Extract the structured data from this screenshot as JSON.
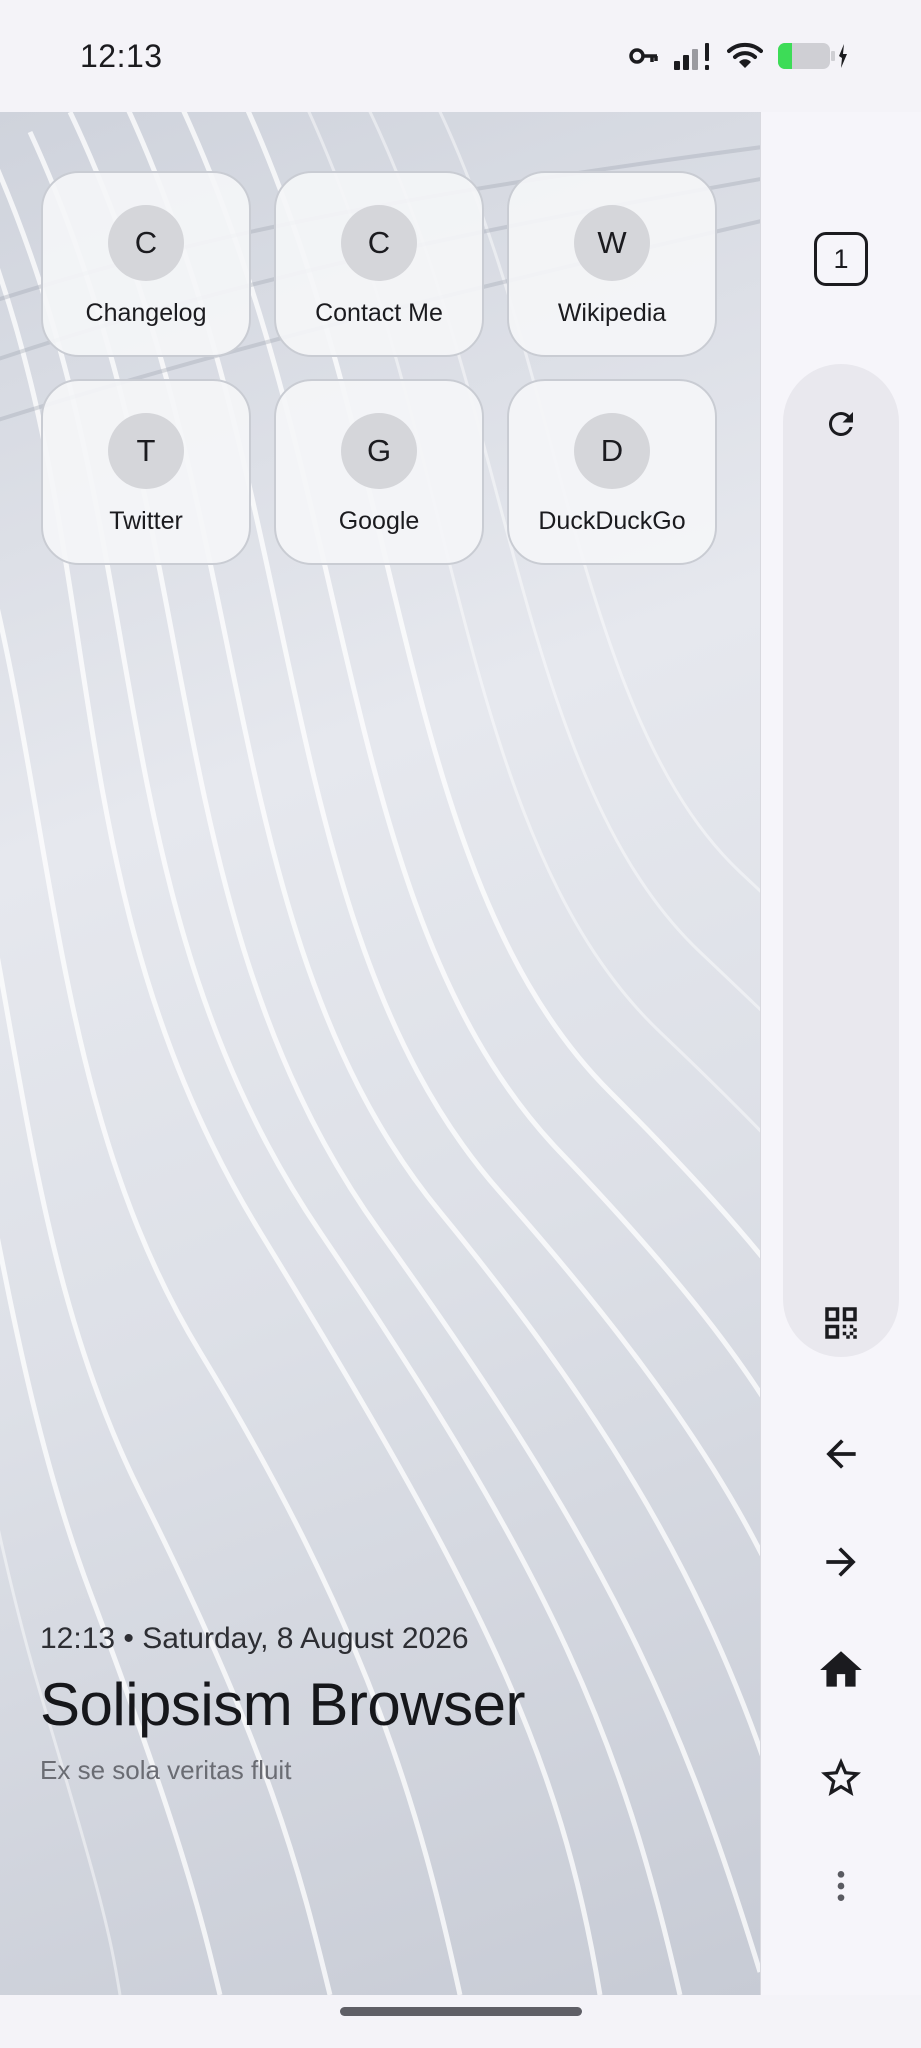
{
  "status_bar": {
    "time": "12:13",
    "icons": [
      "vpn-key-icon",
      "cellular-signal-icon",
      "wifi-icon",
      "battery-charging-icon"
    ],
    "battery_color": "#3ddc57"
  },
  "speed_dial": [
    {
      "initial": "C",
      "label": "Changelog"
    },
    {
      "initial": "C",
      "label": "Contact Me"
    },
    {
      "initial": "W",
      "label": "Wikipedia"
    },
    {
      "initial": "T",
      "label": "Twitter"
    },
    {
      "initial": "G",
      "label": "Google"
    },
    {
      "initial": "D",
      "label": "DuckDuckGo"
    }
  ],
  "info": {
    "datetime": "12:13 • Saturday, 8 August 2026",
    "title": "Solipsism Browser",
    "subtitle": "Ex se sola veritas fluit"
  },
  "toolbar": {
    "tab_count": "1",
    "icons": [
      "reload-icon",
      "qr-code-icon",
      "back-arrow-icon",
      "forward-arrow-icon",
      "home-icon",
      "star-icon",
      "more-vert-icon"
    ]
  }
}
